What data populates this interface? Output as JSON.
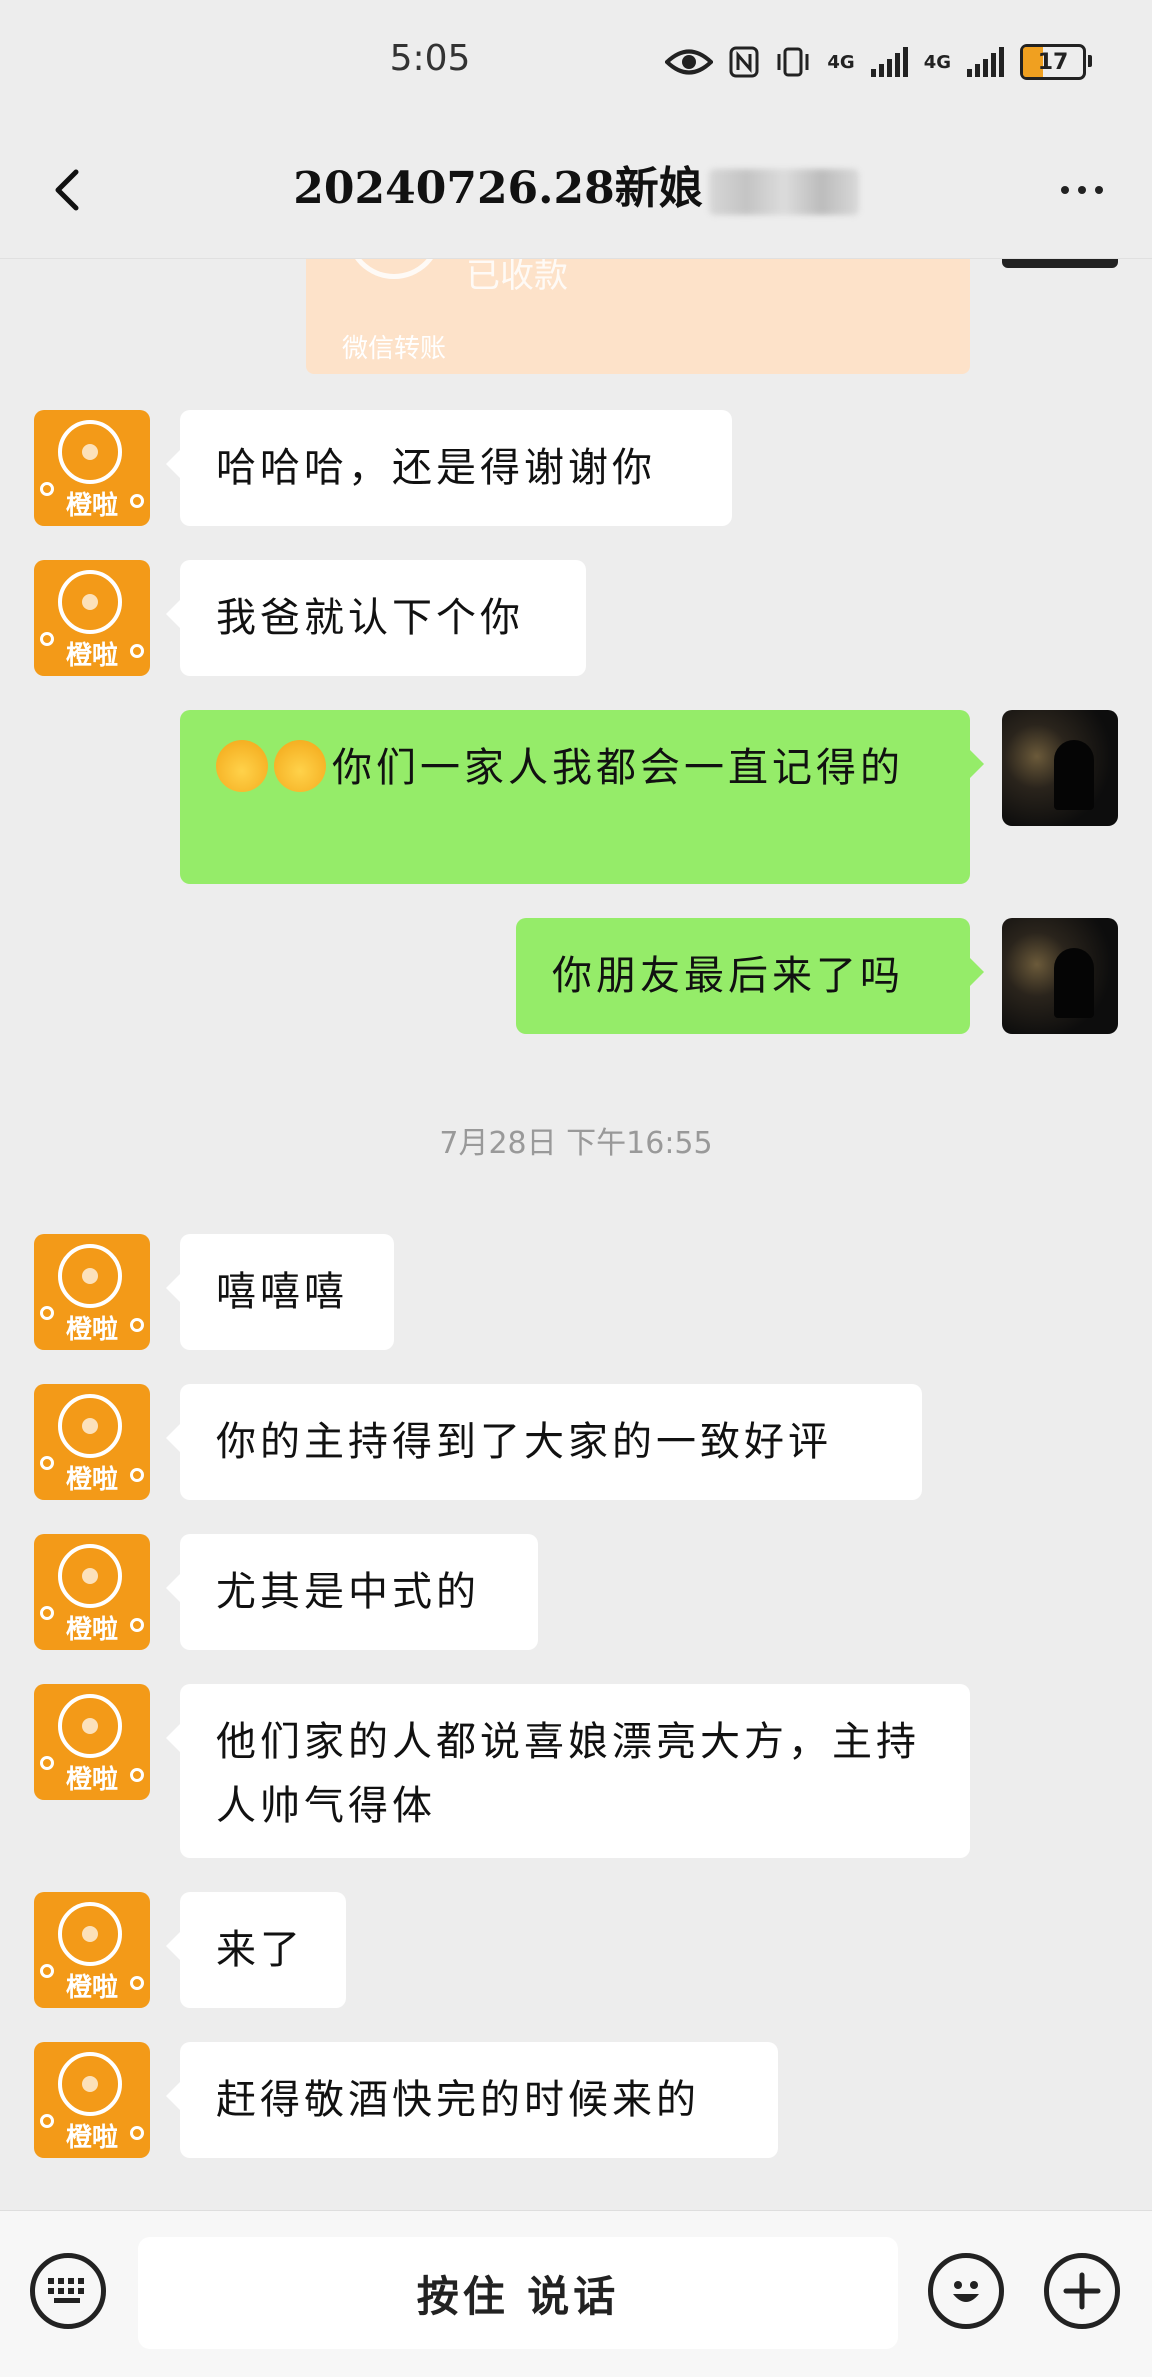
{
  "status_bar": {
    "time": "5:05",
    "battery": "17",
    "net1": "4G",
    "net2": "4G"
  },
  "header": {
    "title": "20240726.28新娘"
  },
  "transfer": {
    "status": "已收款",
    "label": "微信转账"
  },
  "messages": [
    {
      "side": "in",
      "text": "哈哈哈，还是得谢谢你"
    },
    {
      "side": "in",
      "text": "我爸就认下个你"
    },
    {
      "side": "out",
      "text": "你们一家人我都会一直记得的"
    },
    {
      "side": "out",
      "text": "你朋友最后来了吗"
    },
    {
      "timestamp": "7月28日 下午16:55"
    },
    {
      "side": "in",
      "text": "嘻嘻嘻"
    },
    {
      "side": "in",
      "text": "你的主持得到了大家的一致好评"
    },
    {
      "side": "in",
      "text": "尤其是中式的"
    },
    {
      "side": "in",
      "text": "他们家的人都说喜娘漂亮大方，主持人帅气得体"
    },
    {
      "side": "in",
      "text": "来了"
    },
    {
      "side": "in",
      "text": "赶得敬酒快完的时候来的"
    }
  ],
  "avatar_brand": "橙啦",
  "input": {
    "hold_to_talk": "按住 说话"
  },
  "icons": [
    "back-icon",
    "more-icon",
    "keyboard-icon",
    "emoji-icon",
    "plus-icon"
  ],
  "colors": {
    "outgoing_bubble": "#95ec69",
    "incoming_bubble": "#ffffff",
    "background": "#ededed",
    "transfer_card": "#fde2c9",
    "avatar_orange": "#f39a18"
  }
}
